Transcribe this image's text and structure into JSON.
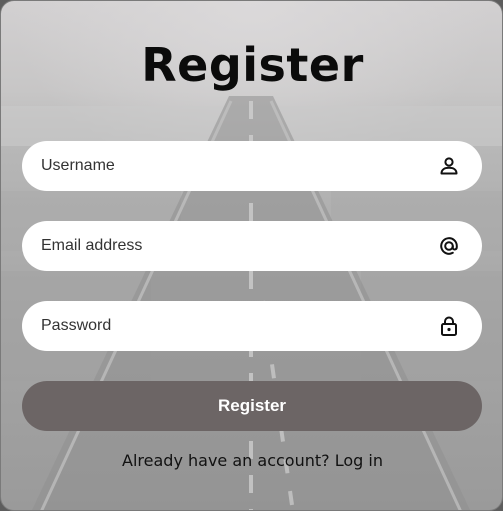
{
  "form": {
    "title": "Register",
    "username": {
      "placeholder": "Username",
      "value": "",
      "icon": "user-icon"
    },
    "email": {
      "placeholder": "Email address",
      "value": "",
      "icon": "at-sign-icon"
    },
    "password": {
      "placeholder": "Password",
      "value": "",
      "icon": "lock-icon"
    },
    "submit_label": "Register",
    "footer_text": "Already have an account?",
    "login_link": "Log in"
  },
  "colors": {
    "button_bg": "#6c6565",
    "field_bg": "#ffffff",
    "title": "#0b0b0b"
  }
}
